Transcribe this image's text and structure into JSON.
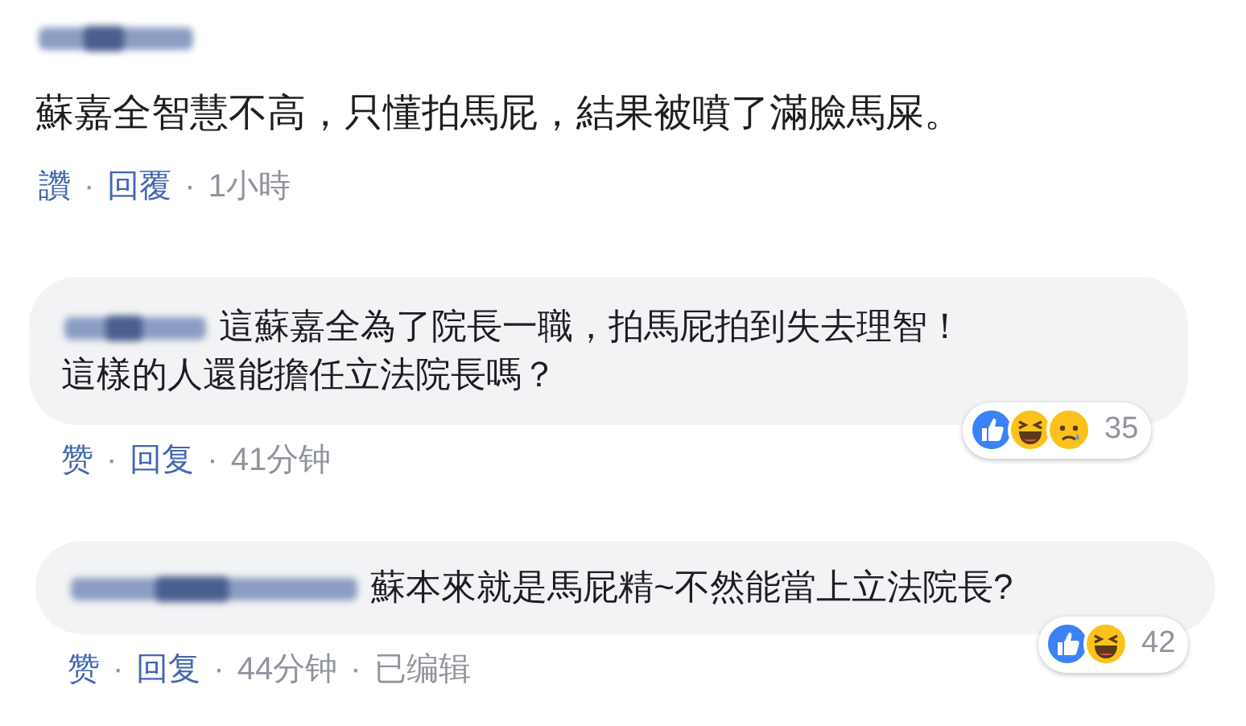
{
  "separator": "·",
  "comments": [
    {
      "kind": "plain",
      "lines": [
        "蘇嘉全智慧不高，只懂拍馬屁，結果被噴了滿臉馬屎。"
      ],
      "actions": [
        {
          "kind": "link",
          "label": "讚"
        },
        {
          "kind": "link",
          "label": "回覆"
        },
        {
          "kind": "time",
          "label": "1小時"
        }
      ]
    },
    {
      "kind": "bubble",
      "lines": [
        "這蘇嘉全為了院長一職，拍馬屁拍到失去理智！",
        "這樣的人還能擔任立法院長嗎？"
      ],
      "actions": [
        {
          "kind": "link",
          "label": "赞"
        },
        {
          "kind": "link",
          "label": "回复"
        },
        {
          "kind": "time",
          "label": "41分钟"
        }
      ],
      "reactions": {
        "items": [
          {
            "kind": "like"
          },
          {
            "kind": "haha"
          },
          {
            "kind": "sad"
          }
        ],
        "count": "35"
      }
    },
    {
      "kind": "bubble",
      "lines": [
        "蘇本來就是馬屁精~不然能當上立法院長?"
      ],
      "actions": [
        {
          "kind": "link",
          "label": "赞"
        },
        {
          "kind": "link",
          "label": "回复"
        },
        {
          "kind": "time",
          "label": "44分钟"
        },
        {
          "kind": "time",
          "label": "已编辑"
        }
      ],
      "reactions": {
        "items": [
          {
            "kind": "like"
          },
          {
            "kind": "haha"
          }
        ],
        "count": "42"
      }
    }
  ]
}
